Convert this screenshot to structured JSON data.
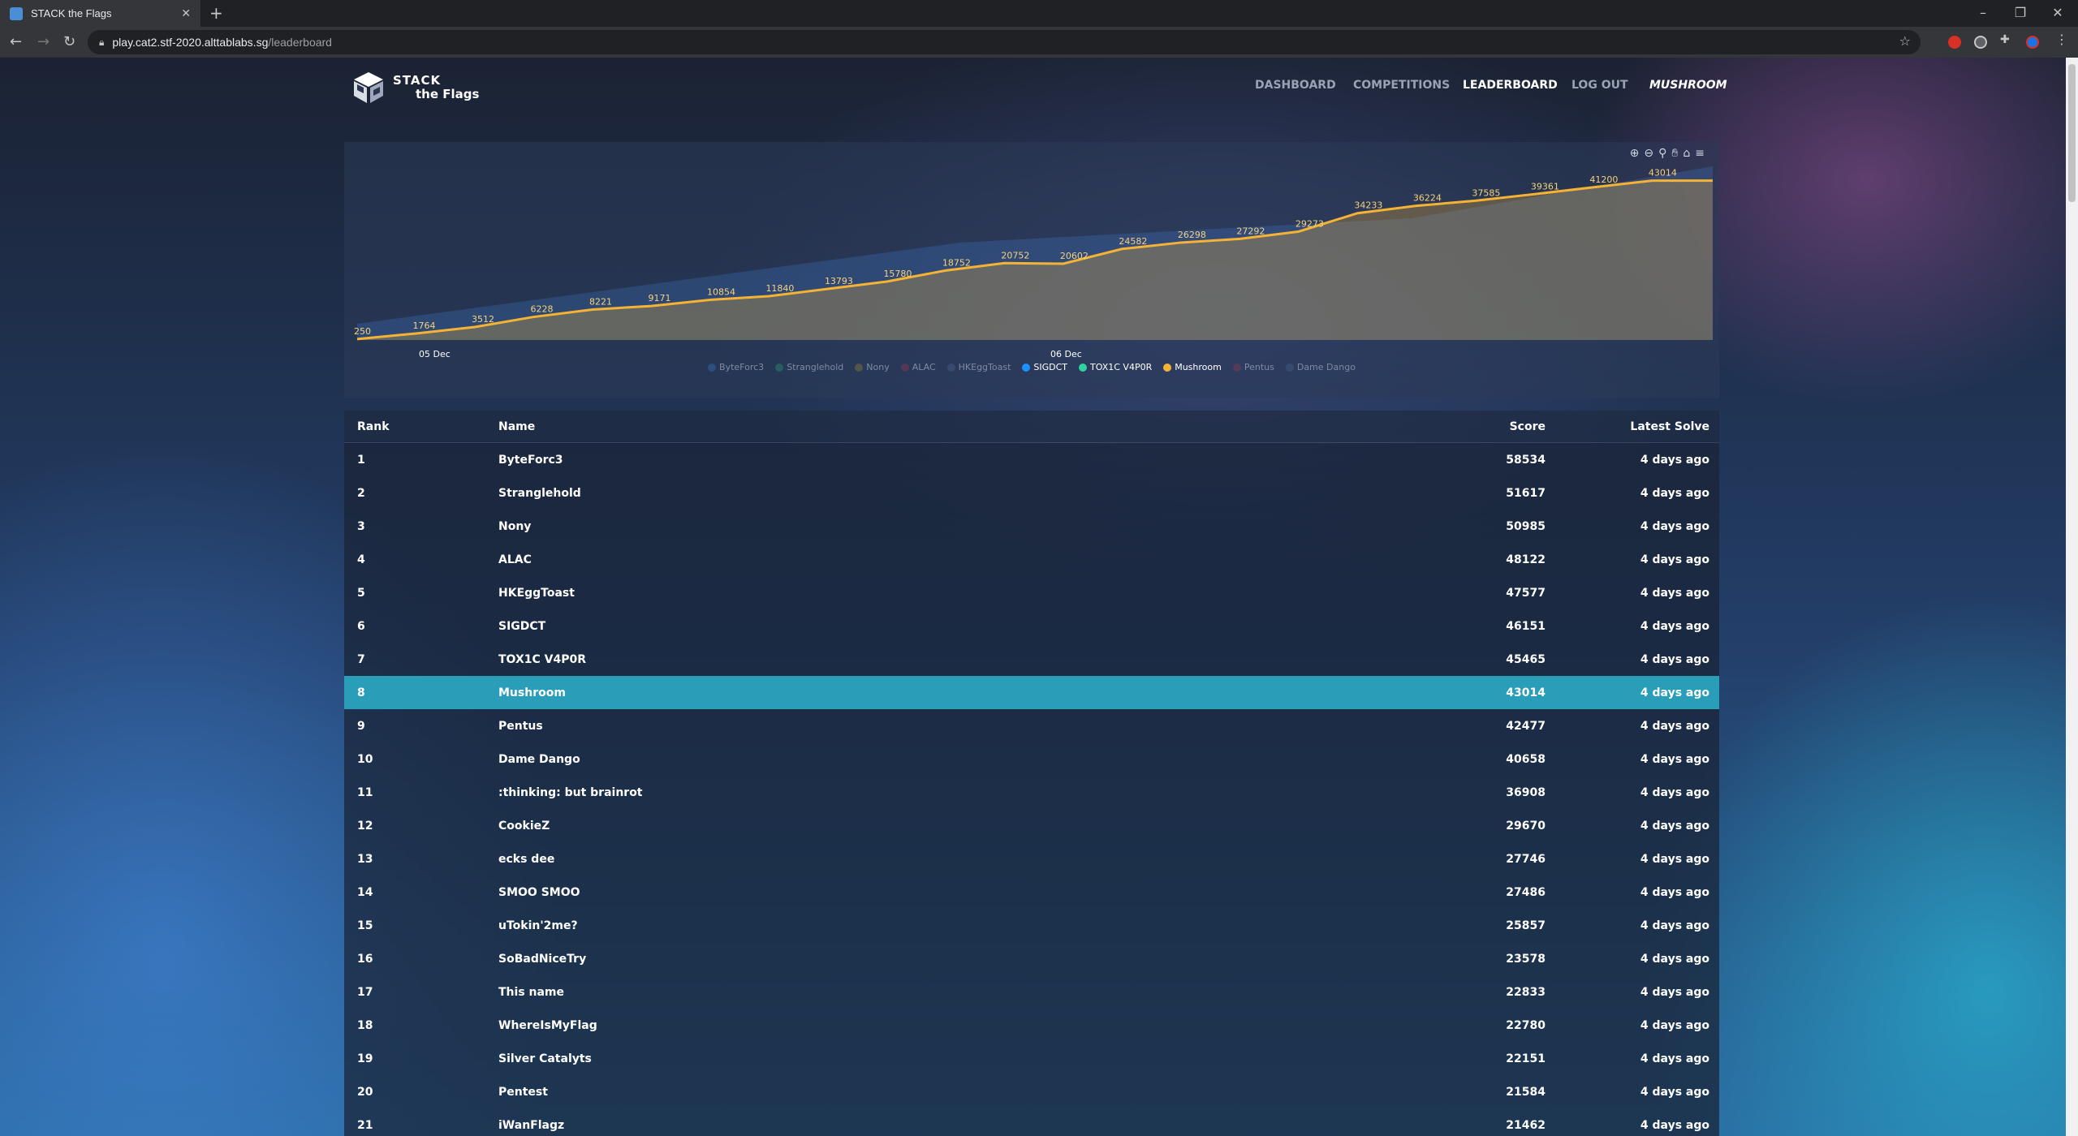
{
  "browser": {
    "tab_title": "STACK the Flags",
    "tab_close": "✕",
    "new_tab": "+",
    "url_host": "play.cat2.stf-2020.alttablabs.sg",
    "url_path": "/leaderboard"
  },
  "site": {
    "logo_line1": "STACK",
    "logo_line2": "the Flags",
    "nav": {
      "dashboard": "DASHBOARD",
      "competitions": "COMPETITIONS",
      "leaderboard": "LEADERBOARD",
      "logout": "LOG OUT",
      "user": "MUSHROOM"
    }
  },
  "chart_data": {
    "type": "line",
    "title": "",
    "x_ticks": [
      "05 Dec",
      "06 Dec"
    ],
    "series": [
      {
        "name": "Mushroom",
        "color": "#f5b335",
        "labels": [
          "250",
          "1764",
          "3512",
          "6228",
          "8221",
          "9171",
          "10854",
          "11840",
          "13793",
          "15780",
          "18752",
          "20752",
          "20602",
          "24582",
          "26298",
          "27292",
          "29273",
          "34233",
          "36224",
          "37585",
          "39361",
          "41200",
          "43014"
        ],
        "values": [
          250,
          1764,
          3512,
          6228,
          8221,
          9171,
          10854,
          11840,
          13793,
          15780,
          18752,
          20752,
          20602,
          24582,
          26298,
          27292,
          29273,
          34233,
          36224,
          37585,
          39361,
          41200,
          43014
        ]
      }
    ],
    "legend": [
      {
        "name": "ByteForc3",
        "color": "#3a6db0",
        "active": false
      },
      {
        "name": "Stranglehold",
        "color": "#2f8a6f",
        "active": false
      },
      {
        "name": "Nony",
        "color": "#8a7a3a",
        "active": false
      },
      {
        "name": "ALAC",
        "color": "#8a3a4f",
        "active": false
      },
      {
        "name": "HKEggToast",
        "color": "#4a5a8a",
        "active": false
      },
      {
        "name": "SIGDCT",
        "color": "#1e90ff",
        "active": true
      },
      {
        "name": "TOX1C V4P0R",
        "color": "#2ed3a0",
        "active": true
      },
      {
        "name": "Mushroom",
        "color": "#f5b335",
        "active": true
      },
      {
        "name": "Pentus",
        "color": "#8a3a4f",
        "active": false
      },
      {
        "name": "Dame Dango",
        "color": "#4a5a8a",
        "active": false
      }
    ],
    "legend_position": "bottom",
    "grid": false
  },
  "table": {
    "headers": {
      "rank": "Rank",
      "name": "Name",
      "score": "Score",
      "latest": "Latest Solve"
    },
    "rows": [
      {
        "rank": "1",
        "name": "ByteForc3",
        "score": "58534",
        "latest": "4 days ago"
      },
      {
        "rank": "2",
        "name": "Stranglehold",
        "score": "51617",
        "latest": "4 days ago"
      },
      {
        "rank": "3",
        "name": "Nony",
        "score": "50985",
        "latest": "4 days ago"
      },
      {
        "rank": "4",
        "name": "ALAC",
        "score": "48122",
        "latest": "4 days ago"
      },
      {
        "rank": "5",
        "name": "HKEggToast",
        "score": "47577",
        "latest": "4 days ago"
      },
      {
        "rank": "6",
        "name": "SIGDCT",
        "score": "46151",
        "latest": "4 days ago"
      },
      {
        "rank": "7",
        "name": "TOX1C V4P0R",
        "score": "45465",
        "latest": "4 days ago"
      },
      {
        "rank": "8",
        "name": "Mushroom",
        "score": "43014",
        "latest": "4 days ago"
      },
      {
        "rank": "9",
        "name": "Pentus",
        "score": "42477",
        "latest": "4 days ago"
      },
      {
        "rank": "10",
        "name": "Dame Dango",
        "score": "40658",
        "latest": "4 days ago"
      },
      {
        "rank": "11",
        "name": ":thinking: but brainrot",
        "score": "36908",
        "latest": "4 days ago"
      },
      {
        "rank": "12",
        "name": "CookieZ",
        "score": "29670",
        "latest": "4 days ago"
      },
      {
        "rank": "13",
        "name": "ecks dee",
        "score": "27746",
        "latest": "4 days ago"
      },
      {
        "rank": "14",
        "name": "SMOO SMOO",
        "score": "27486",
        "latest": "4 days ago"
      },
      {
        "rank": "15",
        "name": "uTokin'2me?",
        "score": "25857",
        "latest": "4 days ago"
      },
      {
        "rank": "16",
        "name": "SoBadNiceTry",
        "score": "23578",
        "latest": "4 days ago"
      },
      {
        "rank": "17",
        "name": "This name",
        "score": "22833",
        "latest": "4 days ago"
      },
      {
        "rank": "18",
        "name": "WhereIsMyFlag",
        "score": "22780",
        "latest": "4 days ago"
      },
      {
        "rank": "19",
        "name": "Silver Catalyts",
        "score": "22151",
        "latest": "4 days ago"
      },
      {
        "rank": "20",
        "name": "Pentest",
        "score": "21584",
        "latest": "4 days ago"
      },
      {
        "rank": "21",
        "name": "iWanFlagz",
        "score": "21462",
        "latest": "4 days ago"
      }
    ],
    "highlight_rank": "8",
    "highlight_color": "#2a9db8"
  }
}
